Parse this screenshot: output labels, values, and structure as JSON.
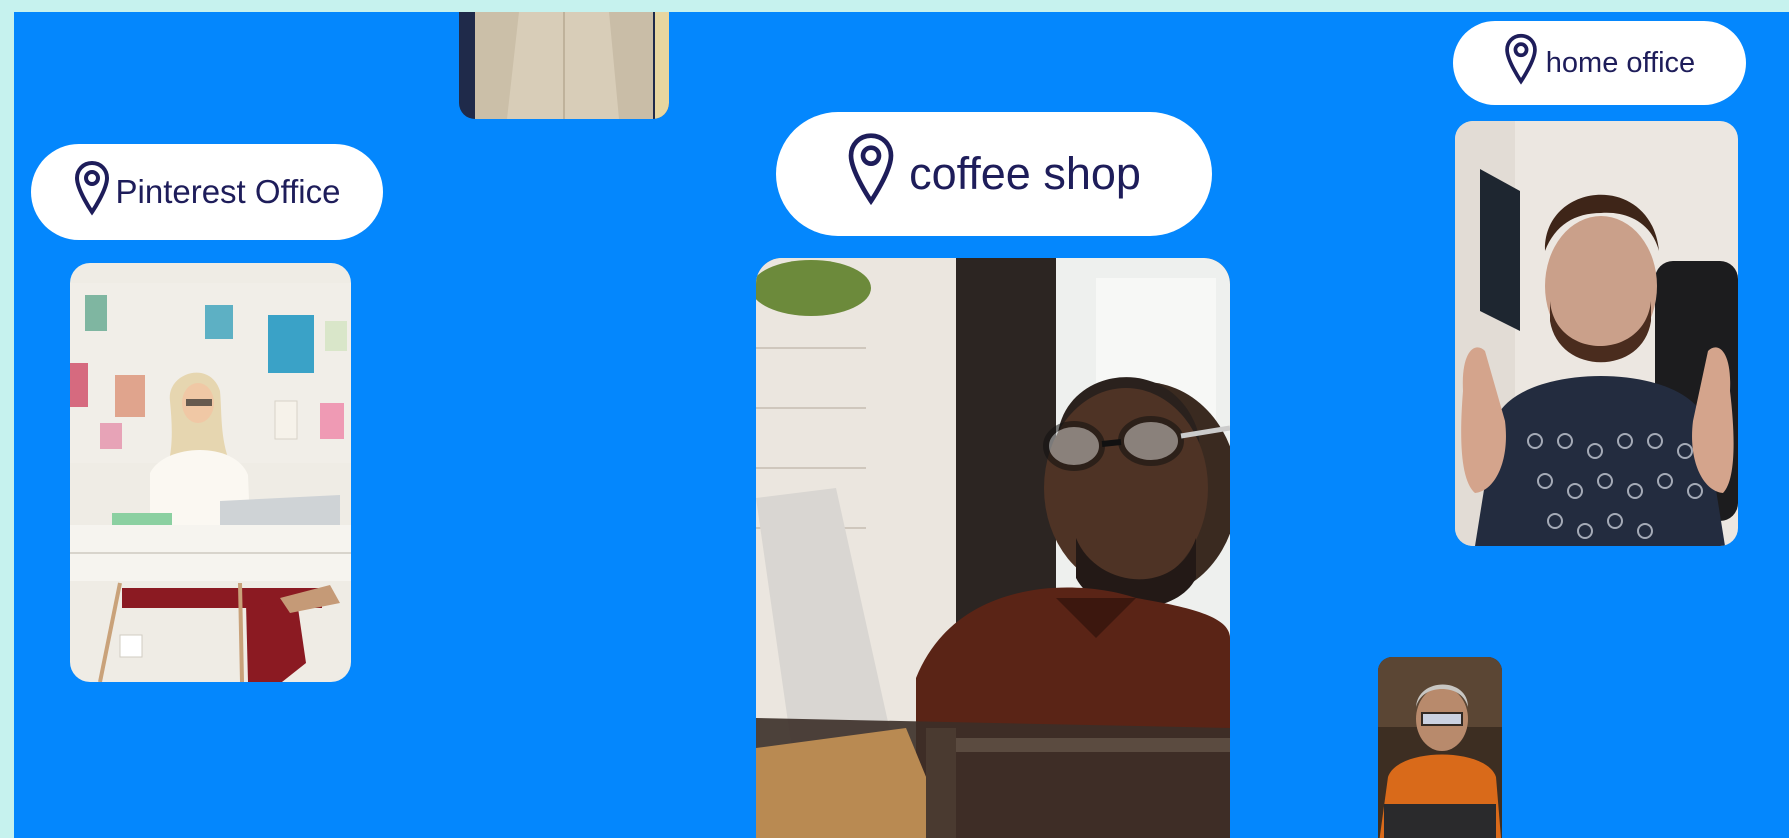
{
  "location_tags": {
    "pinterest_office": "Pinterest Office",
    "coffee_shop": "coffee shop",
    "home_office": "home office"
  },
  "icons": {
    "location": "map-pin-icon"
  },
  "colors": {
    "background": "#0487fd",
    "frame": "#c6f2ee",
    "pill": "#ffffff",
    "pill_text": "#1e1d5a"
  }
}
